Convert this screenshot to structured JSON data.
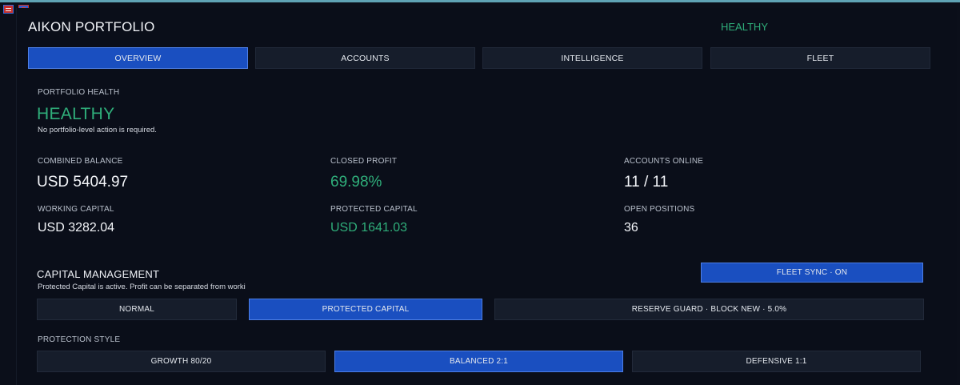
{
  "app": {
    "title": "AIKON PORTFOLIO",
    "status": "HEALTHY"
  },
  "tabs": [
    {
      "label": "OVERVIEW",
      "active": true
    },
    {
      "label": "ACCOUNTS",
      "active": false
    },
    {
      "label": "INTELLIGENCE",
      "active": false
    },
    {
      "label": "FLEET",
      "active": false
    }
  ],
  "health": {
    "label": "PORTFOLIO HEALTH",
    "value": "HEALTHY",
    "note": "No portfolio-level action is required."
  },
  "metrics": {
    "combined_balance": {
      "label": "COMBINED BALANCE",
      "value": "USD 5404.97"
    },
    "closed_profit": {
      "label": "CLOSED PROFIT",
      "value": "69.98%"
    },
    "accounts_online": {
      "label": "ACCOUNTS ONLINE",
      "value": "11 / 11"
    },
    "working_capital": {
      "label": "WORKING CAPITAL",
      "value": "USD 3282.04"
    },
    "protected_capital": {
      "label": "PROTECTED CAPITAL",
      "value": "USD 1641.03"
    },
    "open_positions": {
      "label": "OPEN POSITIONS",
      "value": "36"
    }
  },
  "capital": {
    "title": "CAPITAL MANAGEMENT",
    "note": "Protected Capital is active. Profit can be separated from worki",
    "fleet_sync": "FLEET SYNC · ON",
    "modes": [
      {
        "label": "NORMAL",
        "active": false
      },
      {
        "label": "PROTECTED CAPITAL",
        "active": true
      },
      {
        "label": "RESERVE GUARD · BLOCK NEW · 5.0%",
        "active": false
      }
    ]
  },
  "protection": {
    "label": "PROTECTION STYLE",
    "styles": [
      {
        "label": "GROWTH 80/20",
        "active": false
      },
      {
        "label": "BALANCED 2:1",
        "active": true
      },
      {
        "label": "DEFENSIVE 1:1",
        "active": false
      }
    ]
  },
  "colors": {
    "accent": "#1a4fc0",
    "healthy": "#2fae7a",
    "background": "#0b0f1a"
  }
}
